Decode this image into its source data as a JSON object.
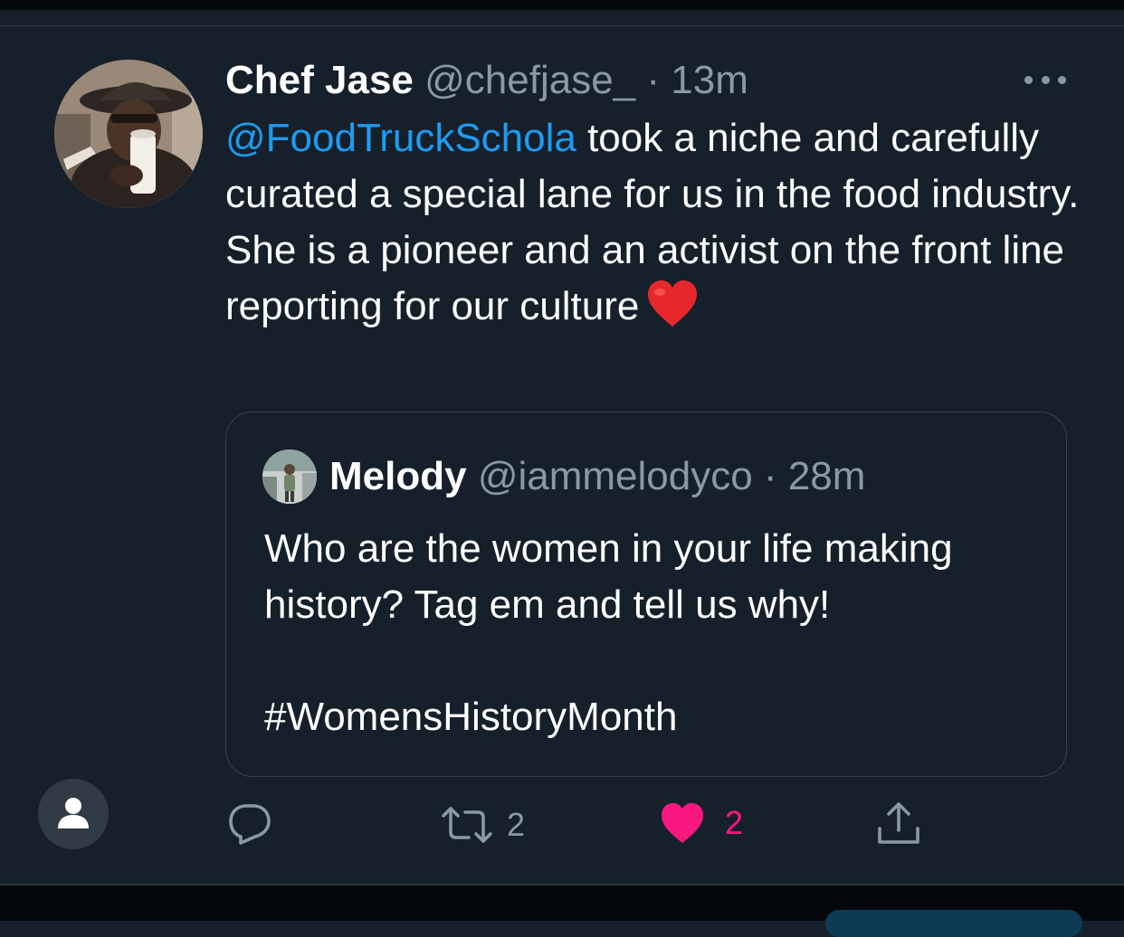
{
  "tweet": {
    "author_name": "Chef Jase",
    "author_handle": "@chefjase_",
    "separator": "·",
    "time": "13m",
    "mention": "@FoodTruckSchola",
    "text": " took a niche and carefully curated a special lane for us in the food industry. She is a pioneer and an activist on the front line reporting for our culture"
  },
  "quoted_tweet": {
    "author_name": "Melody",
    "author_handle": "@iammelodyco",
    "separator": "·",
    "time": "28m",
    "text": "Who are the women in your life making history? Tag em and tell us why!",
    "hashtag": "#WomensHistoryMonth"
  },
  "actions": {
    "reply_icon": "reply-icon",
    "retweet_icon": "retweet-icon",
    "retweet_count": "2",
    "like_icon": "heart-filled-icon",
    "like_count": "2",
    "share_icon": "share-icon"
  },
  "colors": {
    "background": "#15202b",
    "mention": "#1d9bf0",
    "secondary_text": "#8b98a5",
    "like": "#f91880",
    "heart_emoji": "#e8272c"
  }
}
